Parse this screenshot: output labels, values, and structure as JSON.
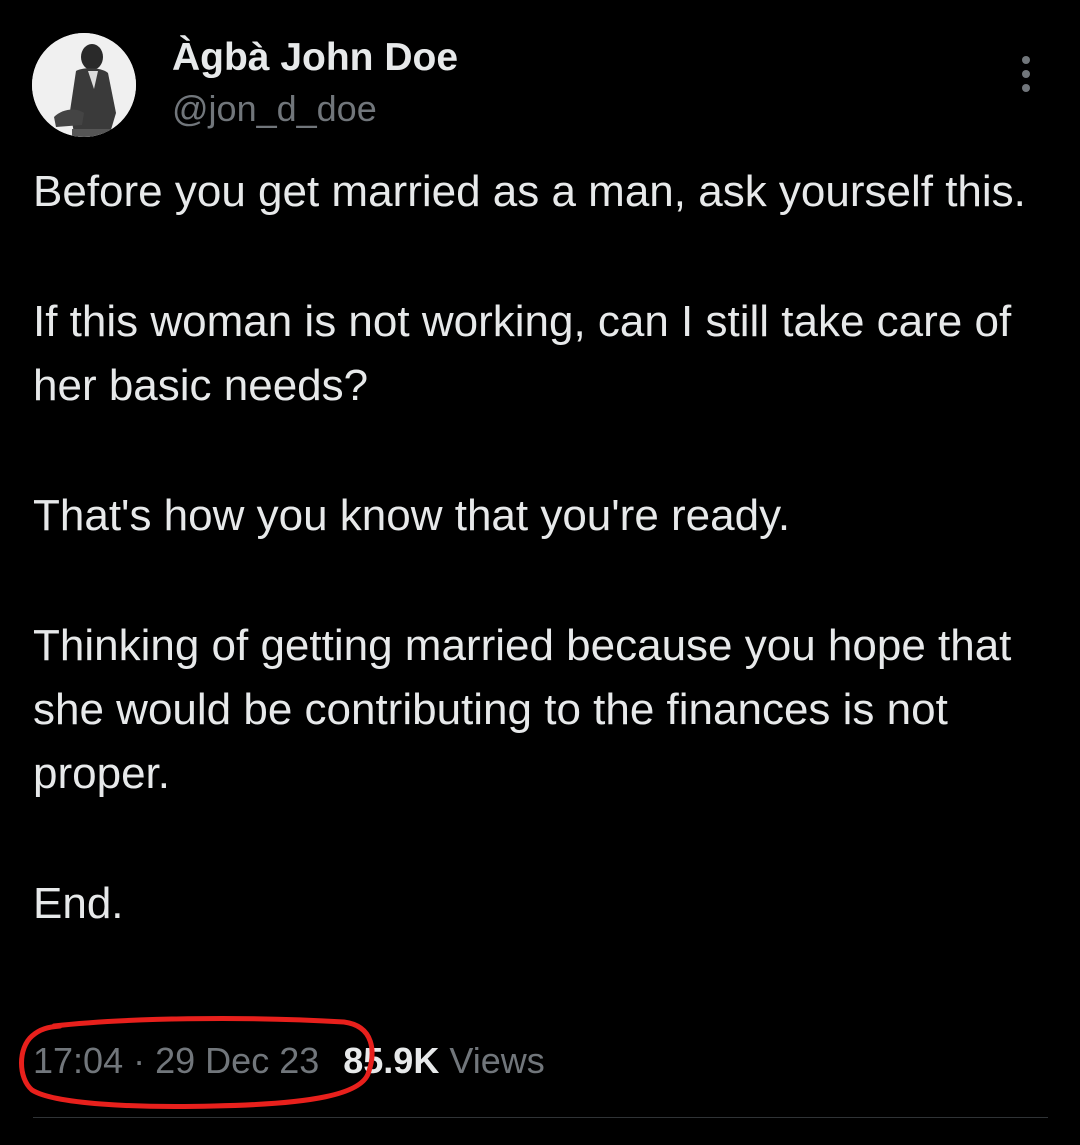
{
  "author": {
    "display_name": "Àgbà John Doe",
    "handle": "@jon_d_doe",
    "avatar_icon": "user-avatar-photo"
  },
  "more_icon": "more-vertical-icon",
  "tweet": {
    "paragraphs": [
      "Before you get married as a man, ask yourself this.",
      "If this woman is not working, can I still take care of her basic needs?",
      "That's how you know that you're ready.",
      "Thinking of getting married because you hope that she would be contributing to the finances is not proper.",
      "End."
    ]
  },
  "meta": {
    "time": "17:04",
    "separator": "·",
    "date": "29 Dec 23",
    "views_count": "85.9K",
    "views_label": "Views"
  },
  "colors": {
    "background": "#000000",
    "text_primary": "#e7e9ea",
    "text_secondary": "#71767b",
    "annotation_red": "#e8201c",
    "divider": "#2f3336"
  }
}
